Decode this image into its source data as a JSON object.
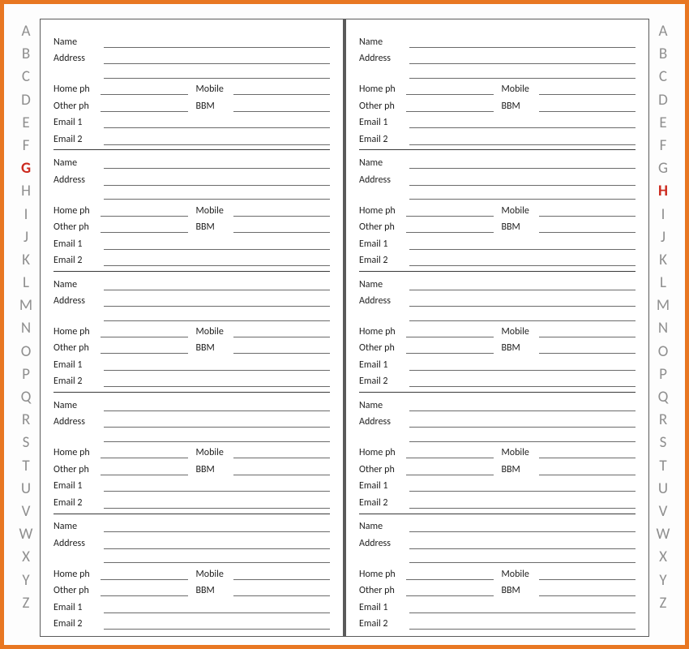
{
  "alphabet_left": [
    "A",
    "B",
    "C",
    "D",
    "E",
    "F",
    "G",
    "H",
    "I",
    "J",
    "K",
    "L",
    "M",
    "N",
    "O",
    "P",
    "Q",
    "R",
    "S",
    "T",
    "U",
    "V",
    "W",
    "X",
    "Y",
    "Z"
  ],
  "alphabet_right": [
    "A",
    "B",
    "C",
    "D",
    "E",
    "F",
    "G",
    "H",
    "I",
    "J",
    "K",
    "L",
    "M",
    "N",
    "O",
    "P",
    "Q",
    "R",
    "S",
    "T",
    "U",
    "V",
    "W",
    "X",
    "Y",
    "Z"
  ],
  "active_left": "G",
  "active_right": "H",
  "fields": {
    "name": "Name",
    "address": "Address",
    "home_ph": "Home ph",
    "mobile": "Mobile",
    "other_ph": "Other ph",
    "bbm": "BBM",
    "email1": "Email 1",
    "email2": "Email 2"
  },
  "entries_per_page": 5
}
